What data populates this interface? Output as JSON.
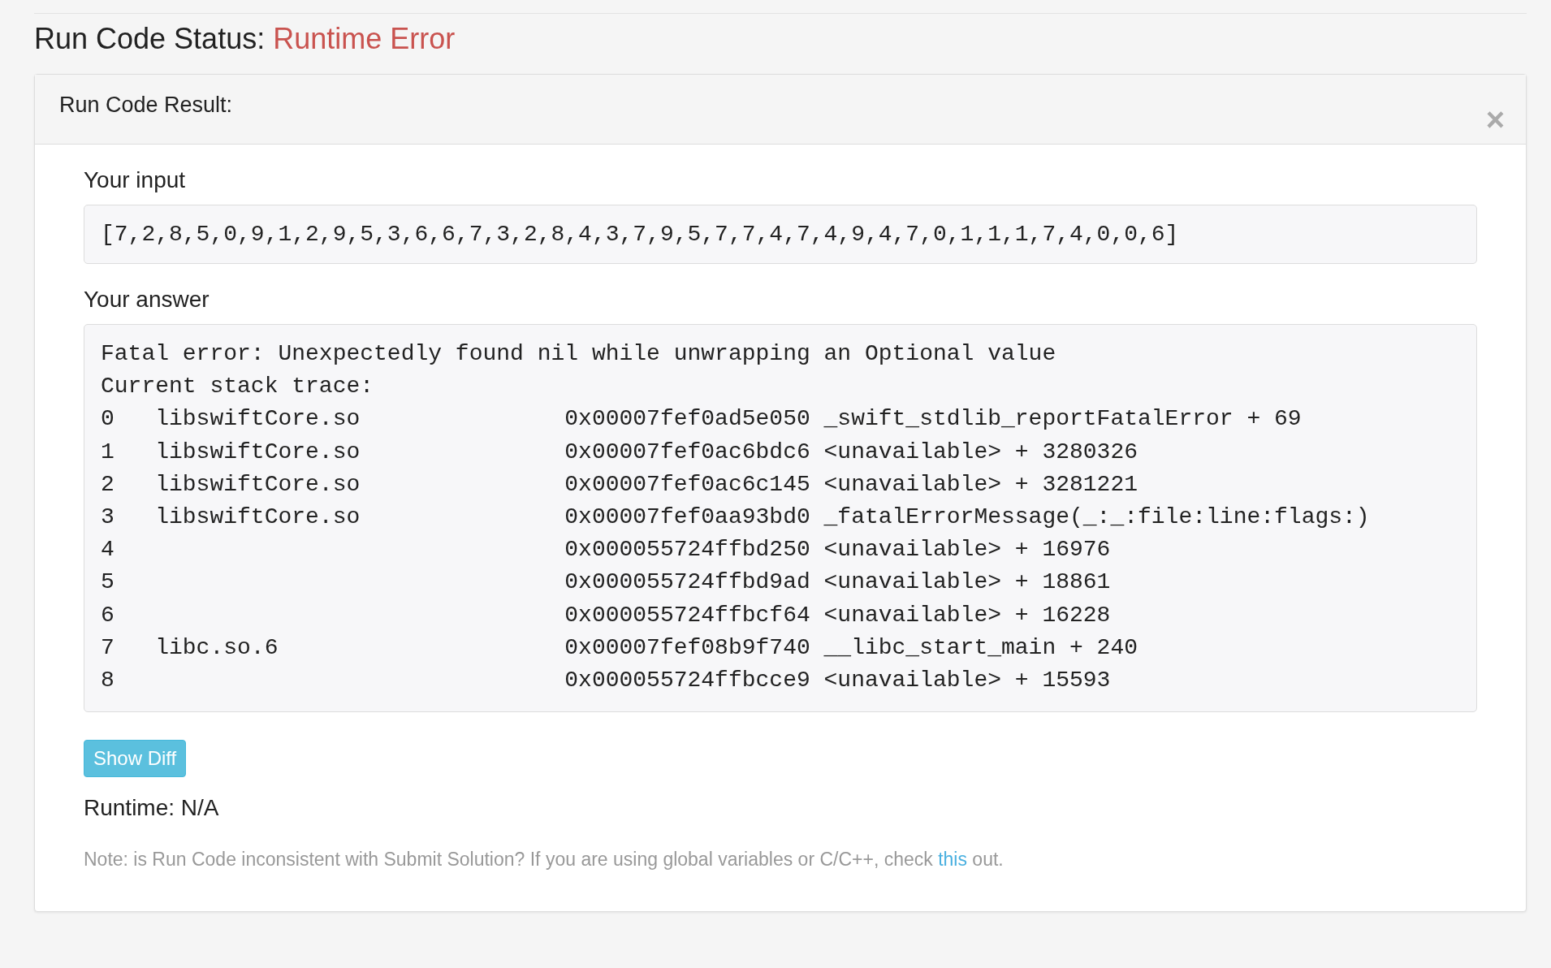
{
  "status": {
    "label": "Run Code Status:",
    "value": "Runtime Error"
  },
  "panel": {
    "title": "Run Code Result:",
    "close": "×",
    "input_label": "Your input",
    "input_value": "[7,2,8,5,0,9,1,2,9,5,3,6,6,7,3,2,8,4,3,7,9,5,7,7,4,7,4,9,4,7,0,1,1,1,7,4,0,0,6]",
    "answer_label": "Your answer",
    "answer_lines": [
      "Fatal error: Unexpectedly found nil while unwrapping an Optional value",
      "Current stack trace:",
      "0   libswiftCore.so               0x00007fef0ad5e050 _swift_stdlib_reportFatalError + 69",
      "1   libswiftCore.so               0x00007fef0ac6bdc6 <unavailable> + 3280326",
      "2   libswiftCore.so               0x00007fef0ac6c145 <unavailable> + 3281221",
      "3   libswiftCore.so               0x00007fef0aa93bd0 _fatalErrorMessage(_:_:file:line:flags:)",
      "4                                 0x000055724ffbd250 <unavailable> + 16976",
      "5                                 0x000055724ffbd9ad <unavailable> + 18861",
      "6                                 0x000055724ffbcf64 <unavailable> + 16228",
      "7   libc.so.6                     0x00007fef08b9f740 __libc_start_main + 240",
      "8                                 0x000055724ffbcce9 <unavailable> + 15593"
    ],
    "button": "Show Diff",
    "runtime": "Runtime: N/A",
    "note": {
      "before": "Note: is Run Code inconsistent with Submit Solution? If you are using global variables or C/C++, check ",
      "link": "this",
      "after": " out."
    }
  }
}
